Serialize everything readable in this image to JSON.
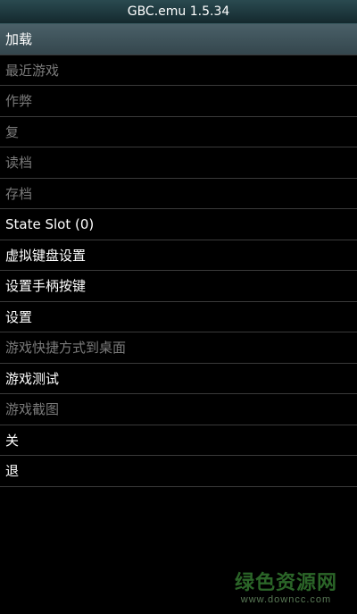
{
  "app": {
    "title": "GBC.emu  1.5.34"
  },
  "menu": {
    "items": [
      {
        "label": "加载",
        "state": "selected"
      },
      {
        "label": "最近游戏",
        "state": "disabled"
      },
      {
        "label": "作弊",
        "state": "disabled"
      },
      {
        "label": "复",
        "state": "disabled"
      },
      {
        "label": "读档",
        "state": "disabled"
      },
      {
        "label": "存档",
        "state": "disabled"
      },
      {
        "label": "State Slot (0)",
        "state": "enabled"
      },
      {
        "label": "虚拟键盘设置",
        "state": "enabled"
      },
      {
        "label": "设置手柄按键",
        "state": "enabled"
      },
      {
        "label": "设置",
        "state": "enabled"
      },
      {
        "label": "游戏快捷方式到桌面",
        "state": "disabled"
      },
      {
        "label": "游戏测试",
        "state": "enabled"
      },
      {
        "label": "游戏截图",
        "state": "disabled"
      },
      {
        "label": "关",
        "state": "enabled"
      },
      {
        "label": "退",
        "state": "enabled"
      }
    ]
  },
  "watermark": {
    "logo": "绿色资源网",
    "url": "www.downcc.com"
  },
  "colors": {
    "selected_bg": "#3f545b",
    "disabled_text": "#7a7a7a",
    "watermark_green": "#4fb84a"
  }
}
